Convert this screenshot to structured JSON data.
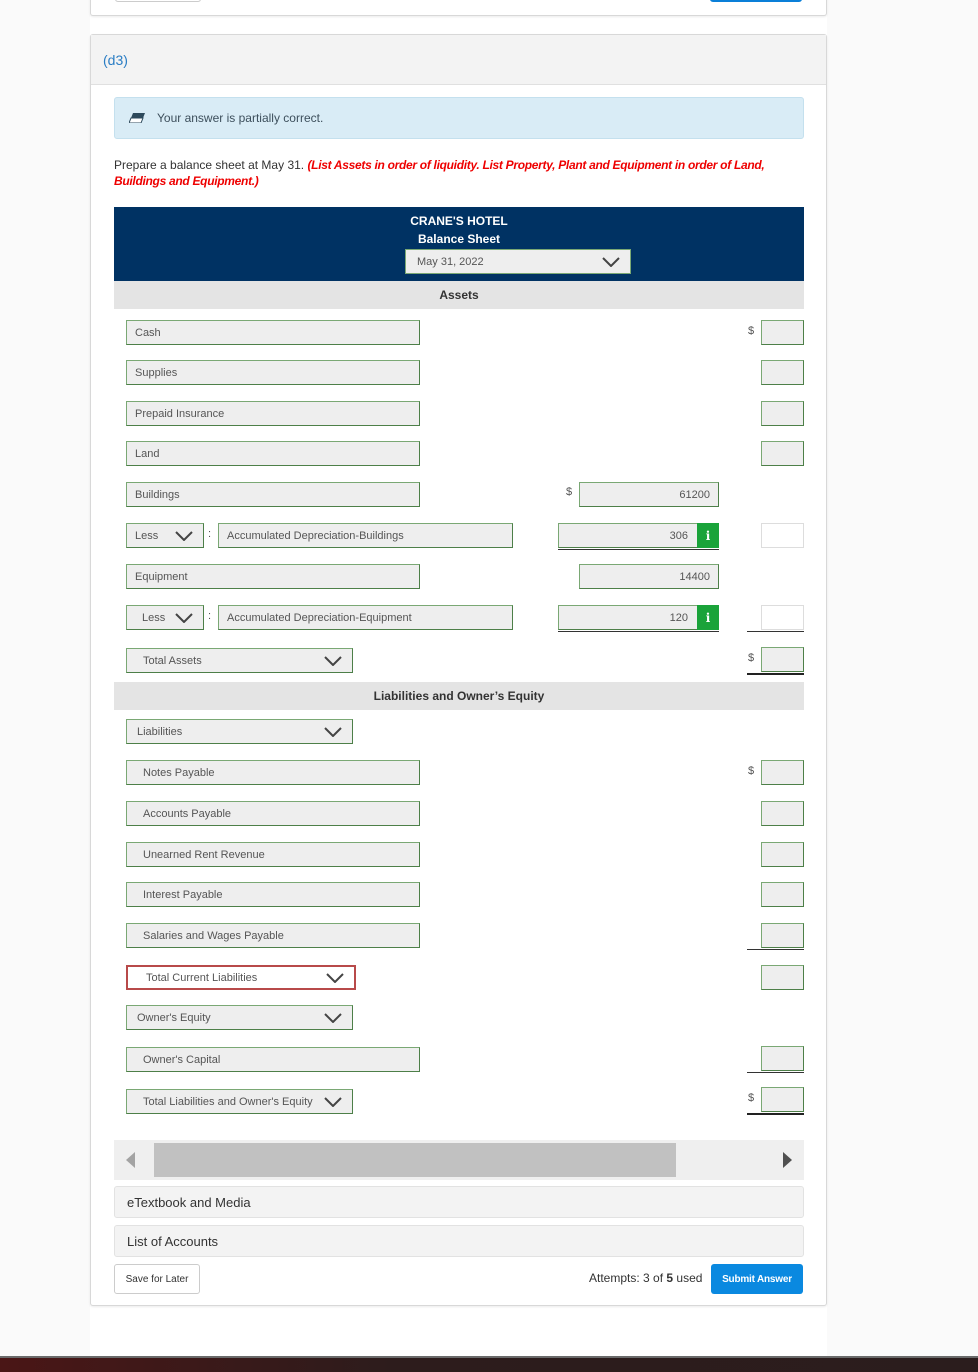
{
  "part_label": "(d3)",
  "feedback": {
    "icon": "eraser-icon",
    "message": "Your answer is partially correct."
  },
  "instructions": {
    "text": "Prepare a balance sheet at May 31.",
    "note": "(List Assets in order of liquidity. List Property, Plant and Equipment in order of Land, Buildings and Equipment.)"
  },
  "sheet": {
    "company": "CRANE'S HOTEL",
    "title": "Balance Sheet",
    "date_selected": "May 31, 2022"
  },
  "assets": {
    "heading": "Assets",
    "currency_symbol": "$",
    "rows": [
      {
        "account": "Cash",
        "amount": ""
      },
      {
        "account": "Supplies",
        "amount": ""
      },
      {
        "account": "Prepaid Insurance",
        "amount": ""
      },
      {
        "account": "Land",
        "amount": ""
      },
      {
        "account": "Buildings",
        "col1_amount": "61200"
      },
      {
        "modifier": "Less",
        "account": "Accumulated Depreciation-Buildings",
        "col1_amount": "306",
        "info": "i",
        "amount": ""
      },
      {
        "account": "Equipment",
        "col1_amount": "14400"
      },
      {
        "modifier": "Less",
        "account": "Accumulated Depreciation-Equipment",
        "col1_amount": "120",
        "info": "i",
        "amount": ""
      }
    ],
    "total_label": "Total Assets",
    "total_amount": ""
  },
  "liabilities_equity": {
    "heading": "Liabilities and Owner’s Equity",
    "liabilities_label": "Liabilities",
    "rows": [
      {
        "account": "Notes Payable",
        "amount": ""
      },
      {
        "account": "Accounts Payable",
        "amount": ""
      },
      {
        "account": "Unearned Rent Revenue",
        "amount": ""
      },
      {
        "account": "Interest Payable",
        "amount": ""
      },
      {
        "account": "Salaries and Wages Payable",
        "amount": ""
      }
    ],
    "total_current_label": "Total Current Liabilities",
    "total_current_amount": "",
    "equity_label": "Owner's Equity",
    "capital_account": "Owner's Capital",
    "capital_amount": "",
    "total_label": "Total Liabilities and Owner's Equity",
    "total_amount": ""
  },
  "accordions": [
    "eTextbook and Media",
    "List of Accounts"
  ],
  "footer": {
    "save_label": "Save for Later",
    "attempts_prefix": "Attempts: ",
    "attempts_used": "3",
    "attempts_mid": " of ",
    "attempts_total": "5",
    "attempts_suffix": " used",
    "submit_label": "Submit Answer"
  },
  "colors": {
    "header_navy": "#003263",
    "link_blue": "#2a7dc4",
    "submit_blue": "#0a89e0",
    "correct_green": "#7aa874",
    "info_green": "#1aa33a",
    "error_red": "#b84a4a",
    "instruction_red": "#ee0000"
  }
}
